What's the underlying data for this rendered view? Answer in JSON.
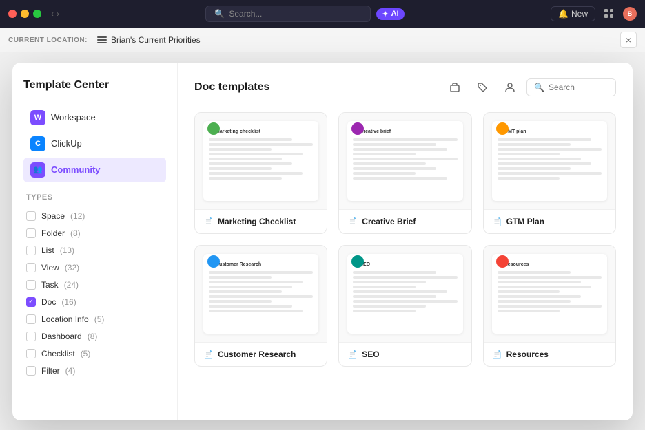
{
  "topbar": {
    "search_placeholder": "Search...",
    "ai_label": "AI",
    "new_label": "New"
  },
  "location_bar": {
    "label": "CURRENT LOCATION:",
    "value": "Brian's Current Priorities",
    "close_label": "×"
  },
  "sidebar": {
    "title": "Template Center",
    "nav_items": [
      {
        "id": "workspace",
        "label": "Workspace",
        "icon": "W",
        "color": "workspace",
        "active": false
      },
      {
        "id": "clickup",
        "label": "ClickUp",
        "icon": "C",
        "color": "clickup",
        "active": false
      },
      {
        "id": "community",
        "label": "Community",
        "icon": "👥",
        "color": "community",
        "active": true
      }
    ],
    "types_title": "Types",
    "types": [
      {
        "id": "space",
        "label": "Space",
        "count": 12,
        "checked": false
      },
      {
        "id": "folder",
        "label": "Folder",
        "count": 8,
        "checked": false
      },
      {
        "id": "list",
        "label": "List",
        "count": 13,
        "checked": false
      },
      {
        "id": "view",
        "label": "View",
        "count": 32,
        "checked": false
      },
      {
        "id": "task",
        "label": "Task",
        "count": 24,
        "checked": false
      },
      {
        "id": "doc",
        "label": "Doc",
        "count": 16,
        "checked": true
      },
      {
        "id": "location-info",
        "label": "Location Info",
        "count": 5,
        "checked": false
      },
      {
        "id": "dashboard",
        "label": "Dashboard",
        "count": 8,
        "checked": false
      },
      {
        "id": "checklist",
        "label": "Checklist",
        "count": 5,
        "checked": false
      },
      {
        "id": "filter",
        "label": "Filter",
        "count": 4,
        "checked": false
      }
    ]
  },
  "content": {
    "title": "Doc templates",
    "search_placeholder": "Search",
    "templates": [
      {
        "id": "marketing-checklist",
        "name": "Marketing Checklist",
        "preview_title": "Marketing checklist",
        "avatar_color": "green"
      },
      {
        "id": "creative-brief",
        "name": "Creative Brief",
        "preview_title": "Creative brief",
        "avatar_color": "purple"
      },
      {
        "id": "gtm-plan",
        "name": "GTM Plan",
        "preview_title": "GMT plan",
        "avatar_color": "orange"
      },
      {
        "id": "customer-research",
        "name": "Customer Research",
        "preview_title": "Customer Research",
        "avatar_color": "blue"
      },
      {
        "id": "seo",
        "name": "SEO",
        "preview_title": "SEO",
        "avatar_color": "teal"
      },
      {
        "id": "resources",
        "name": "Resources",
        "preview_title": "Resources",
        "avatar_color": "red"
      }
    ]
  }
}
